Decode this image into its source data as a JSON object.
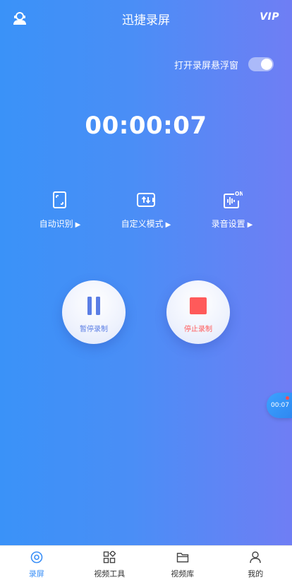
{
  "header": {
    "title": "迅捷录屏",
    "vip_label": "VIP"
  },
  "floating_window": {
    "label": "打开录屏悬浮窗",
    "enabled": true
  },
  "timer": "00:00:07",
  "modes": [
    {
      "label": "自动识别",
      "icon": "phone-rotate-icon"
    },
    {
      "label": "自定义模式",
      "icon": "sliders-icon"
    },
    {
      "label": "录音设置",
      "icon": "audio-wave-icon"
    }
  ],
  "audio_badge": "ON",
  "controls": {
    "pause": {
      "label": "暂停录制",
      "color": "#5b7ee5"
    },
    "stop": {
      "label": "停止录制",
      "color": "#ff5a5a"
    }
  },
  "bubble_timer": "00:07",
  "nav": [
    {
      "label": "录屏",
      "icon": "record-disc-icon",
      "active": true
    },
    {
      "label": "视频工具",
      "icon": "grid-tools-icon",
      "active": false
    },
    {
      "label": "视频库",
      "icon": "folder-icon",
      "active": false
    },
    {
      "label": "我的",
      "icon": "person-icon",
      "active": false
    }
  ],
  "colors": {
    "gradient_start": "#3a92f8",
    "gradient_end": "#6f7ef4",
    "accent": "#3a8ff7"
  }
}
